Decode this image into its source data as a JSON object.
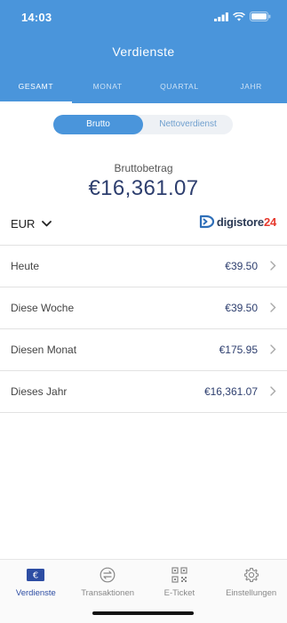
{
  "status": {
    "time": "14:03"
  },
  "header": {
    "title": "Verdienste"
  },
  "tabs": [
    {
      "label": "GESAMT",
      "active": true
    },
    {
      "label": "MONAT",
      "active": false
    },
    {
      "label": "QUARTAL",
      "active": false
    },
    {
      "label": "JAHR",
      "active": false
    }
  ],
  "toggle": {
    "gross_label": "Brutto",
    "net_label": "Nettoverdienst",
    "selected": "Brutto"
  },
  "summary": {
    "label": "Bruttobetrag",
    "value": "€16,361.07"
  },
  "currency": {
    "selected": "EUR"
  },
  "brand": {
    "name": "digistore24",
    "text_main": "digistore",
    "text_accent": "24",
    "accent_color": "#e63a2e"
  },
  "earnings": [
    {
      "label": "Heute",
      "value": "€39.50"
    },
    {
      "label": "Diese Woche",
      "value": "€39.50"
    },
    {
      "label": "Diesen Monat",
      "value": "€175.95"
    },
    {
      "label": "Dieses Jahr",
      "value": "€16,361.07"
    }
  ],
  "bottom_nav": [
    {
      "label": "Verdienste",
      "icon": "euro-card-icon",
      "active": true
    },
    {
      "label": "Transaktionen",
      "icon": "transfer-arrows-icon",
      "active": false
    },
    {
      "label": "E-Ticket",
      "icon": "qr-code-icon",
      "active": false
    },
    {
      "label": "Einstellungen",
      "icon": "gear-icon",
      "active": false
    }
  ],
  "colors": {
    "primary": "#4a95db",
    "amount": "#2d3e6e",
    "nav_active": "#2d4da3"
  }
}
